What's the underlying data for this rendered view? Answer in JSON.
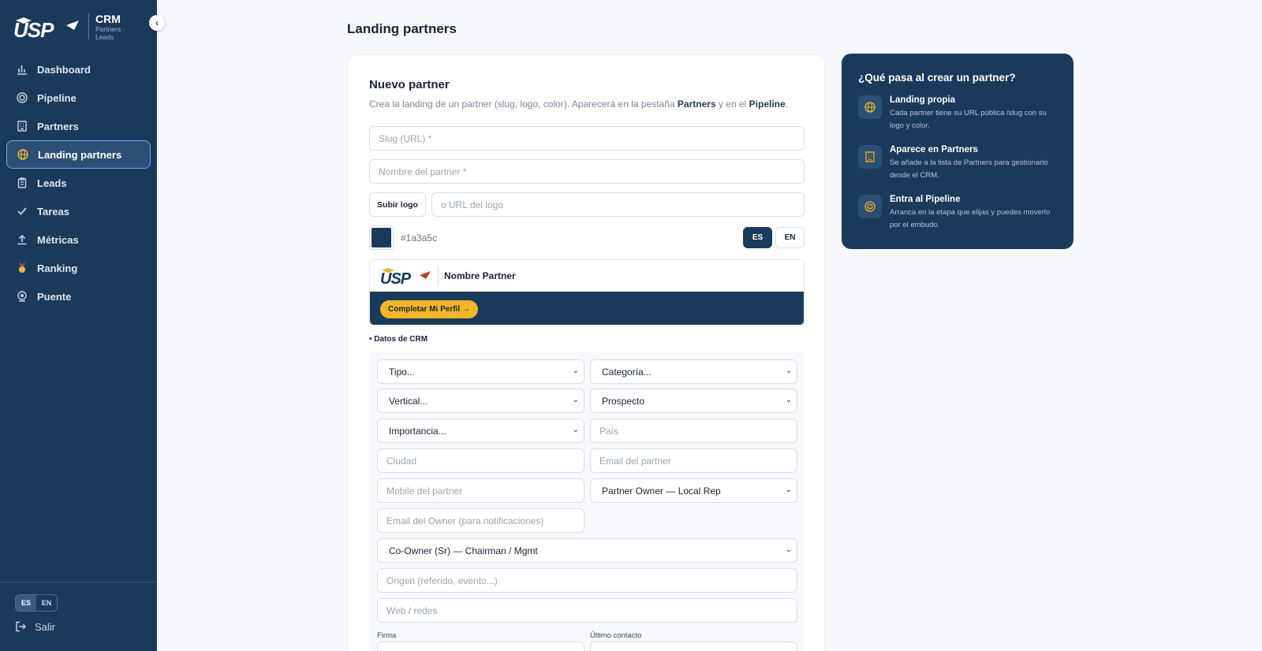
{
  "brand": {
    "title": "CRM",
    "subtitle": "Partners · Leads",
    "logo_text": "USP"
  },
  "sidebar": {
    "items": [
      {
        "label": "Dashboard",
        "icon": "bar-chart-icon"
      },
      {
        "label": "Pipeline",
        "icon": "target-icon"
      },
      {
        "label": "Partners",
        "icon": "building-icon"
      },
      {
        "label": "Landing partners",
        "icon": "globe-icon",
        "active": true
      },
      {
        "label": "Leads",
        "icon": "clipboard-icon"
      },
      {
        "label": "Tareas",
        "icon": "check-icon"
      },
      {
        "label": "Métricas",
        "icon": "upload-icon"
      },
      {
        "label": "Ranking",
        "icon": "medal-icon"
      },
      {
        "label": "Puente",
        "icon": "bridge-icon"
      }
    ],
    "lang": {
      "es": "ES",
      "en": "EN"
    },
    "logout": "Salir"
  },
  "page": {
    "title": "Landing partners"
  },
  "form": {
    "title": "Nuevo partner",
    "desc_prefix": "Crea la landing de un partner (slug, logo, color). Aparecerá en la pestaña ",
    "desc_partners": "Partners",
    "desc_mid": " y en el ",
    "desc_pipeline": "Pipeline",
    "desc_suffix": ".",
    "slug_placeholder": "Slug (URL) *",
    "name_placeholder": "Nombre del partner *",
    "upload_logo": "Subir logo",
    "logo_url_placeholder": "o URL del logo",
    "color_hex": "#1a3a5c",
    "lang_es": "ES",
    "lang_en": "EN",
    "preview": {
      "name": "Nombre Partner",
      "cta": "Completar Mi Perfil →"
    },
    "crm_section": "• Datos de CRM",
    "crm": {
      "tipo": "Tipo...",
      "categoria": "Categoría...",
      "vertical": "Vertical...",
      "prospecto": "Prospecto",
      "importancia": "Importancia...",
      "pais": "País",
      "ciudad": "Ciudad",
      "email_partner": "Email del partner",
      "mobile_partner": "Mobile del partner",
      "partner_owner": "Partner Owner — Local Rep",
      "email_owner": "Email del Owner (para notificaciones)",
      "co_owner": "Co-Owner (Sr) — Chairman / Mgmt",
      "origen": "Origen (referido, evento...)",
      "web": "Web / redes",
      "firma_label": "Firma",
      "ultimo_contacto_label": "Último contacto"
    }
  },
  "info": {
    "title": "¿Qué pasa al crear un partner?",
    "items": [
      {
        "title": "Landing propia",
        "text": "Cada partner tiene su URL pública /slug con su logo y color.",
        "icon": "globe-icon"
      },
      {
        "title": "Aparece en Partners",
        "text": "Se añade a la lista de Partners para gestionarlo desde el CRM.",
        "icon": "building-icon"
      },
      {
        "title": "Entra al Pipeline",
        "text": "Arranca en la etapa que elijas y puedes moverlo por el embudo.",
        "icon": "target-icon"
      }
    ]
  },
  "colors": {
    "navy": "#1a3a5c",
    "accent": "#f2b625",
    "active_border": "#6ba8e8"
  }
}
